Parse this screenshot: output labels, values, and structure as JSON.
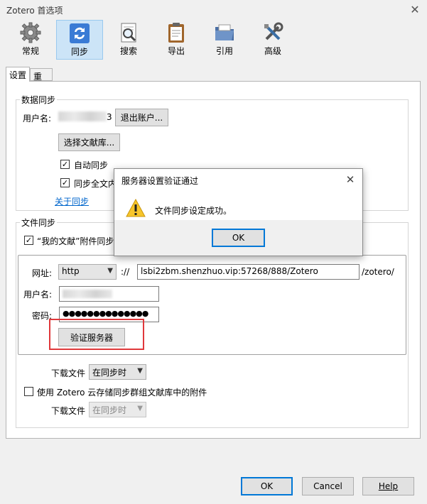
{
  "window": {
    "title": "Zotero 首选项",
    "close_glyph": "✕"
  },
  "toolbar": {
    "items": [
      {
        "label": "常规",
        "icon": "gear-icon"
      },
      {
        "label": "同步",
        "icon": "sync-icon",
        "active": true
      },
      {
        "label": "搜索",
        "icon": "search-icon"
      },
      {
        "label": "导出",
        "icon": "clipboard-icon"
      },
      {
        "label": "引用",
        "icon": "folder-icon"
      },
      {
        "label": "高级",
        "icon": "tools-icon"
      }
    ]
  },
  "tabs": [
    {
      "label": "设置",
      "active": true
    },
    {
      "label": "重置"
    }
  ],
  "data_sync": {
    "legend": "数据同步",
    "username_label": "用户名:",
    "username_suffix": "3",
    "logout_button": "退出账户...",
    "choose_library_button": "选择文献库...",
    "auto_sync_label": "自动同步",
    "auto_sync_checked": true,
    "sync_fulltext_label": "同步全文内",
    "sync_fulltext_checked": true,
    "about_sync_link": "关于同步"
  },
  "file_sync": {
    "legend": "文件同步",
    "my_library_label": "“我的文献”附件同步方",
    "my_library_checked": true,
    "url_label": "网址:",
    "protocol": "http",
    "protocol_sep": "://",
    "url_value": "lsbi2zbm.shenzhuo.vip:57268/888/Zotero",
    "url_suffix": "/zotero/",
    "username_label": "用户名:",
    "password_label": "密码:",
    "password_value": "●●●●●●●●●●●●●●",
    "verify_button": "验证服务器",
    "download_label": "下载文件",
    "download_option": "在同步时",
    "group_label": "使用 Zotero 云存储同步群组文献库中的附件",
    "group_checked": false,
    "group_download_label": "下载文件",
    "group_download_option": "在同步时"
  },
  "footer": {
    "ok": "OK",
    "cancel": "Cancel",
    "help": "Help"
  },
  "dialog": {
    "title": "服务器设置验证通过",
    "close_glyph": "✕",
    "message": "文件同步设定成功。",
    "ok": "OK",
    "icon": "warning-icon"
  },
  "colors": {
    "accent": "#0078d7",
    "highlight": "#e0383b",
    "link": "#0066cc",
    "active_tab_bg": "#cce4f7"
  }
}
